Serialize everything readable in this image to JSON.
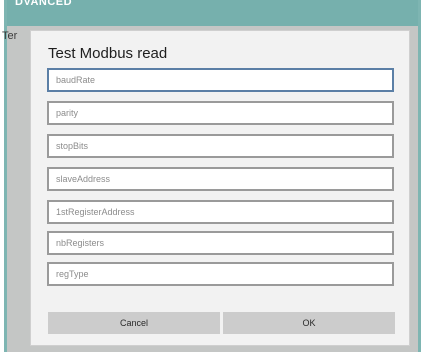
{
  "app": {
    "header_title": "DVANCED",
    "background_label": "Ter"
  },
  "dialog": {
    "title": "Test Modbus read",
    "fields": [
      {
        "placeholder": "baudRate",
        "value": ""
      },
      {
        "placeholder": "parity",
        "value": ""
      },
      {
        "placeholder": "stopBits",
        "value": ""
      },
      {
        "placeholder": "slaveAddress",
        "value": ""
      },
      {
        "placeholder": "1stRegisterAddress",
        "value": ""
      },
      {
        "placeholder": "nbRegisters",
        "value": ""
      },
      {
        "placeholder": "regType",
        "value": ""
      }
    ],
    "cancel_label": "Cancel",
    "ok_label": "OK"
  }
}
